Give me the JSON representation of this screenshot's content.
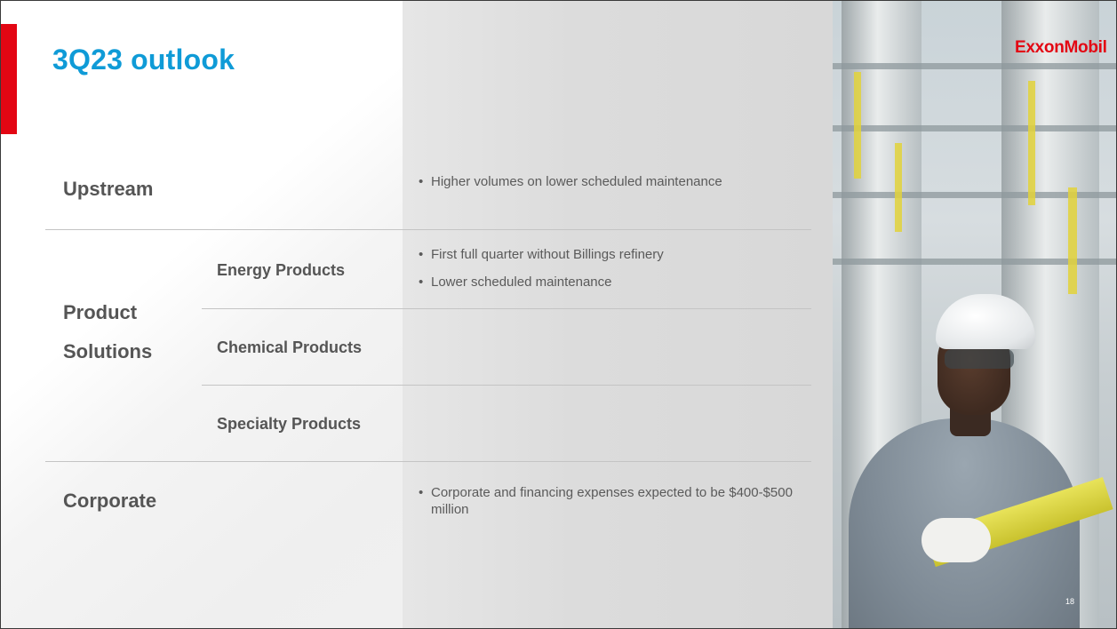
{
  "title": "3Q23 outlook",
  "brand": "ExxonMobil",
  "page_number": "18",
  "segments": {
    "upstream": {
      "label": "Upstream",
      "bullets": [
        "Higher volumes on lower scheduled maintenance"
      ]
    },
    "product_solutions": {
      "label_line1": "Product",
      "label_line2": "Solutions",
      "energy": {
        "label": "Energy Products",
        "bullets": [
          "First full quarter without Billings refinery",
          "Lower scheduled maintenance"
        ]
      },
      "chemical": {
        "label": "Chemical Products"
      },
      "specialty": {
        "label": "Specialty Products"
      }
    },
    "corporate": {
      "label": "Corporate",
      "bullets": [
        "Corporate and financing expenses expected to be $400-$500 million"
      ]
    }
  },
  "colors": {
    "title": "#0f9bd7",
    "accent_red": "#e30613",
    "text": "#555555"
  }
}
